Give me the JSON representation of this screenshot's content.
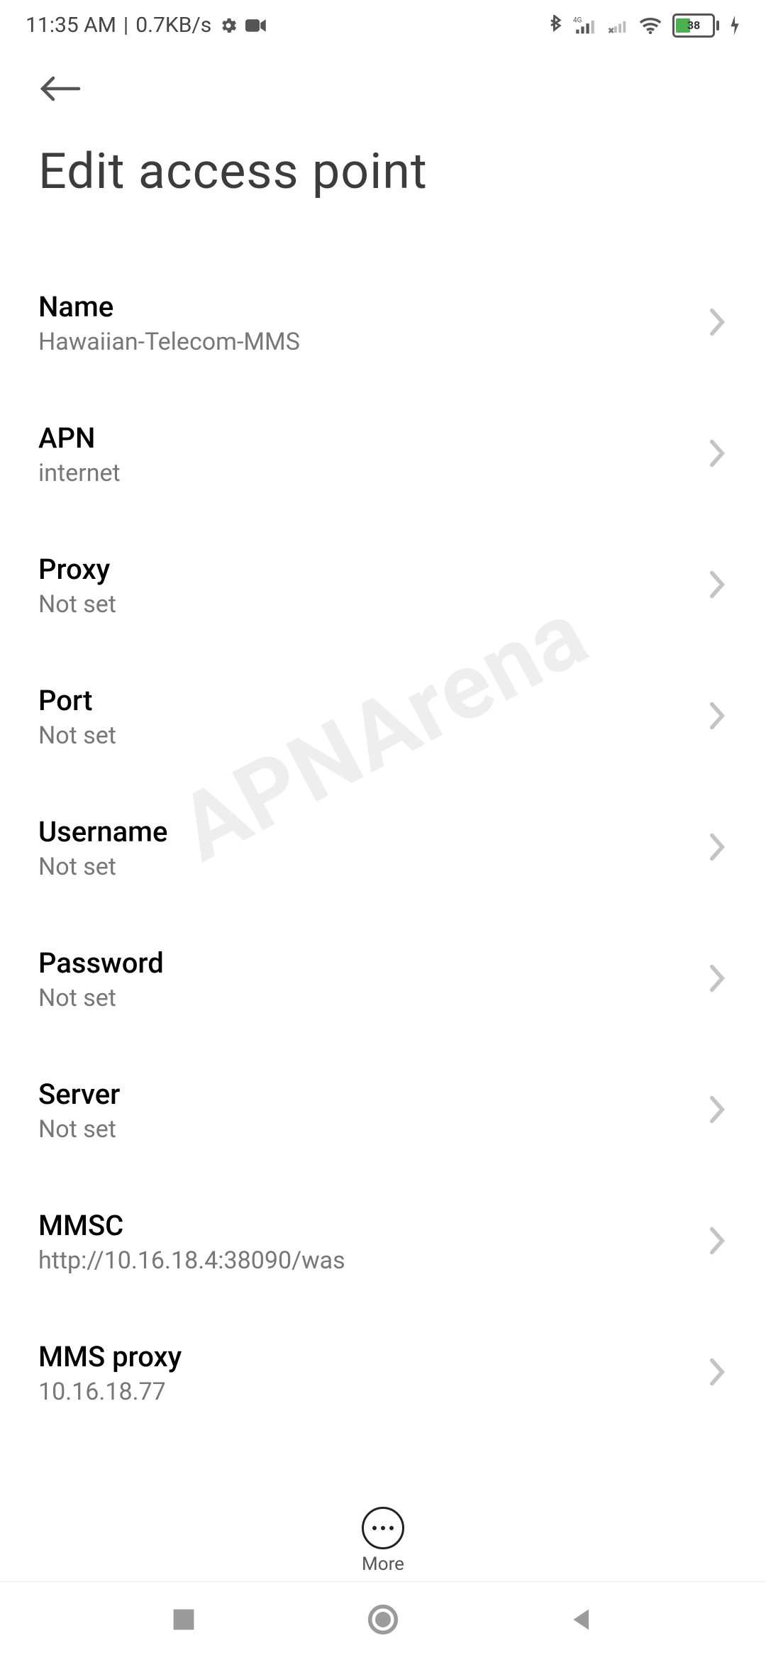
{
  "status": {
    "time": "11:35 AM",
    "net_rate": "0.7KB/s",
    "battery_pct": 38
  },
  "page": {
    "title": "Edit access point"
  },
  "settings": [
    {
      "key": "name",
      "label": "Name",
      "value": "Hawaiian-Telecom-MMS"
    },
    {
      "key": "apn",
      "label": "APN",
      "value": "internet"
    },
    {
      "key": "proxy",
      "label": "Proxy",
      "value": "Not set"
    },
    {
      "key": "port",
      "label": "Port",
      "value": "Not set"
    },
    {
      "key": "username",
      "label": "Username",
      "value": "Not set"
    },
    {
      "key": "password",
      "label": "Password",
      "value": "Not set"
    },
    {
      "key": "server",
      "label": "Server",
      "value": "Not set"
    },
    {
      "key": "mmsc",
      "label": "MMSC",
      "value": "http://10.16.18.4:38090/was"
    },
    {
      "key": "mmsproxy",
      "label": "MMS proxy",
      "value": "10.16.18.77"
    }
  ],
  "more_label": "More",
  "watermark": "APNArena"
}
